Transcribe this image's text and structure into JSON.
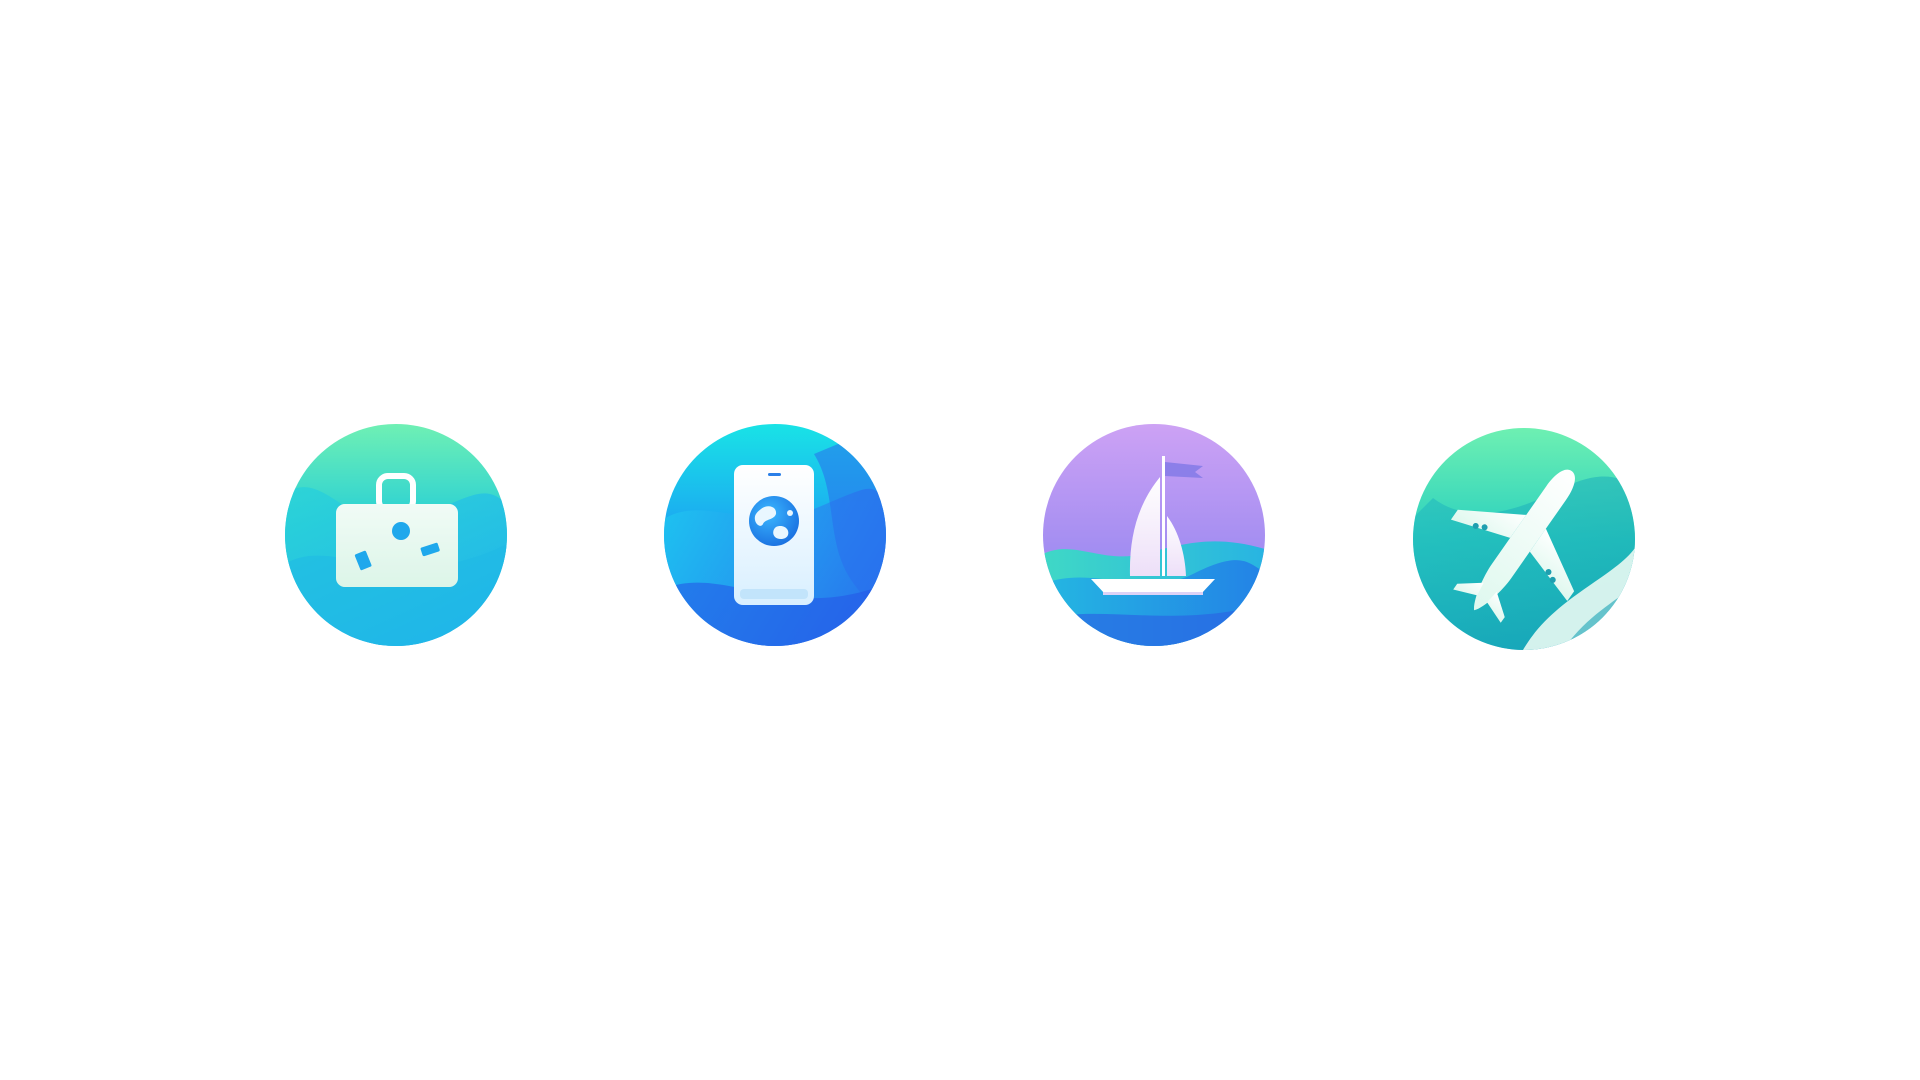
{
  "background_color": "#ffffff",
  "icons": [
    {
      "name": "luggage-icon",
      "palette": [
        "#5ee3b8",
        "#24c8dc",
        "#2aa8f0",
        "#eefaf4",
        "#1fa8ec"
      ]
    },
    {
      "name": "phone-globe-icon",
      "palette": [
        "#21dde8",
        "#1f97f2",
        "#2566ec",
        "#eaf6fd",
        "#1e8fea"
      ]
    },
    {
      "name": "sailboat-icon",
      "palette": [
        "#c89ef4",
        "#9b8cf0",
        "#3cd4c8",
        "#28a6e8",
        "#f7f1fb"
      ]
    },
    {
      "name": "airplane-icon",
      "palette": [
        "#55e2b6",
        "#22c6c0",
        "#17a2b8",
        "#ecfcf6",
        "#1f9fb0"
      ]
    }
  ]
}
